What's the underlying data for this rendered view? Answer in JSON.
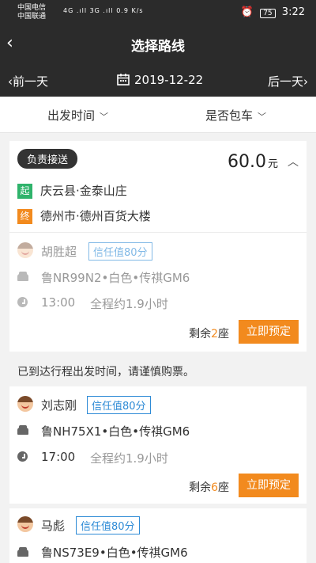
{
  "status_bar": {
    "carrier1": "中国电信",
    "carrier2": "中国联通",
    "signal": "4G .ıll 3G .ıll",
    "speed": "0.9 K/s",
    "battery": "75",
    "time": "3:22"
  },
  "header": {
    "title": "选择路线",
    "prev_day": "前一天",
    "next_day": "后一天",
    "date": "2019-12-22"
  },
  "filters": {
    "departure_time": "出发时间",
    "charter": "是否包车"
  },
  "trip1": {
    "tag": "负责接送",
    "price": "60.0",
    "price_unit": "元",
    "start_label": "起",
    "start": "庆云县·金泰山庄",
    "end_label": "终",
    "end": "德州市·德州百货大楼",
    "driver": "胡胜超",
    "trust": "信任值80分",
    "car": "鲁NR99N2•白色•传祺GM6",
    "time": "13:00",
    "duration": "全程约1.9小时",
    "remain_prefix": "剩余",
    "remain_num": "2",
    "remain_suffix": "座",
    "book": "立即预定"
  },
  "notice": "已到达行程出发时间，请谨慎购票。",
  "trip2": {
    "driver": "刘志刚",
    "trust": "信任值80分",
    "car": "鲁NH75X1•白色•传祺GM6",
    "time": "17:00",
    "duration": "全程约1.9小时",
    "remain_prefix": "剩余",
    "remain_num": "6",
    "remain_suffix": "座",
    "book": "立即预定"
  },
  "trip3": {
    "driver": "马彪",
    "trust": "信任值80分",
    "car": "鲁NS73E9•白色•传祺GM6"
  },
  "icons": {
    "back": "chevron-left-icon",
    "calendar": "calendar-icon",
    "chevron": "chevron-down-icon",
    "car": "car-icon",
    "clock": "clock-icon",
    "avatar": "driver-avatar-icon"
  }
}
